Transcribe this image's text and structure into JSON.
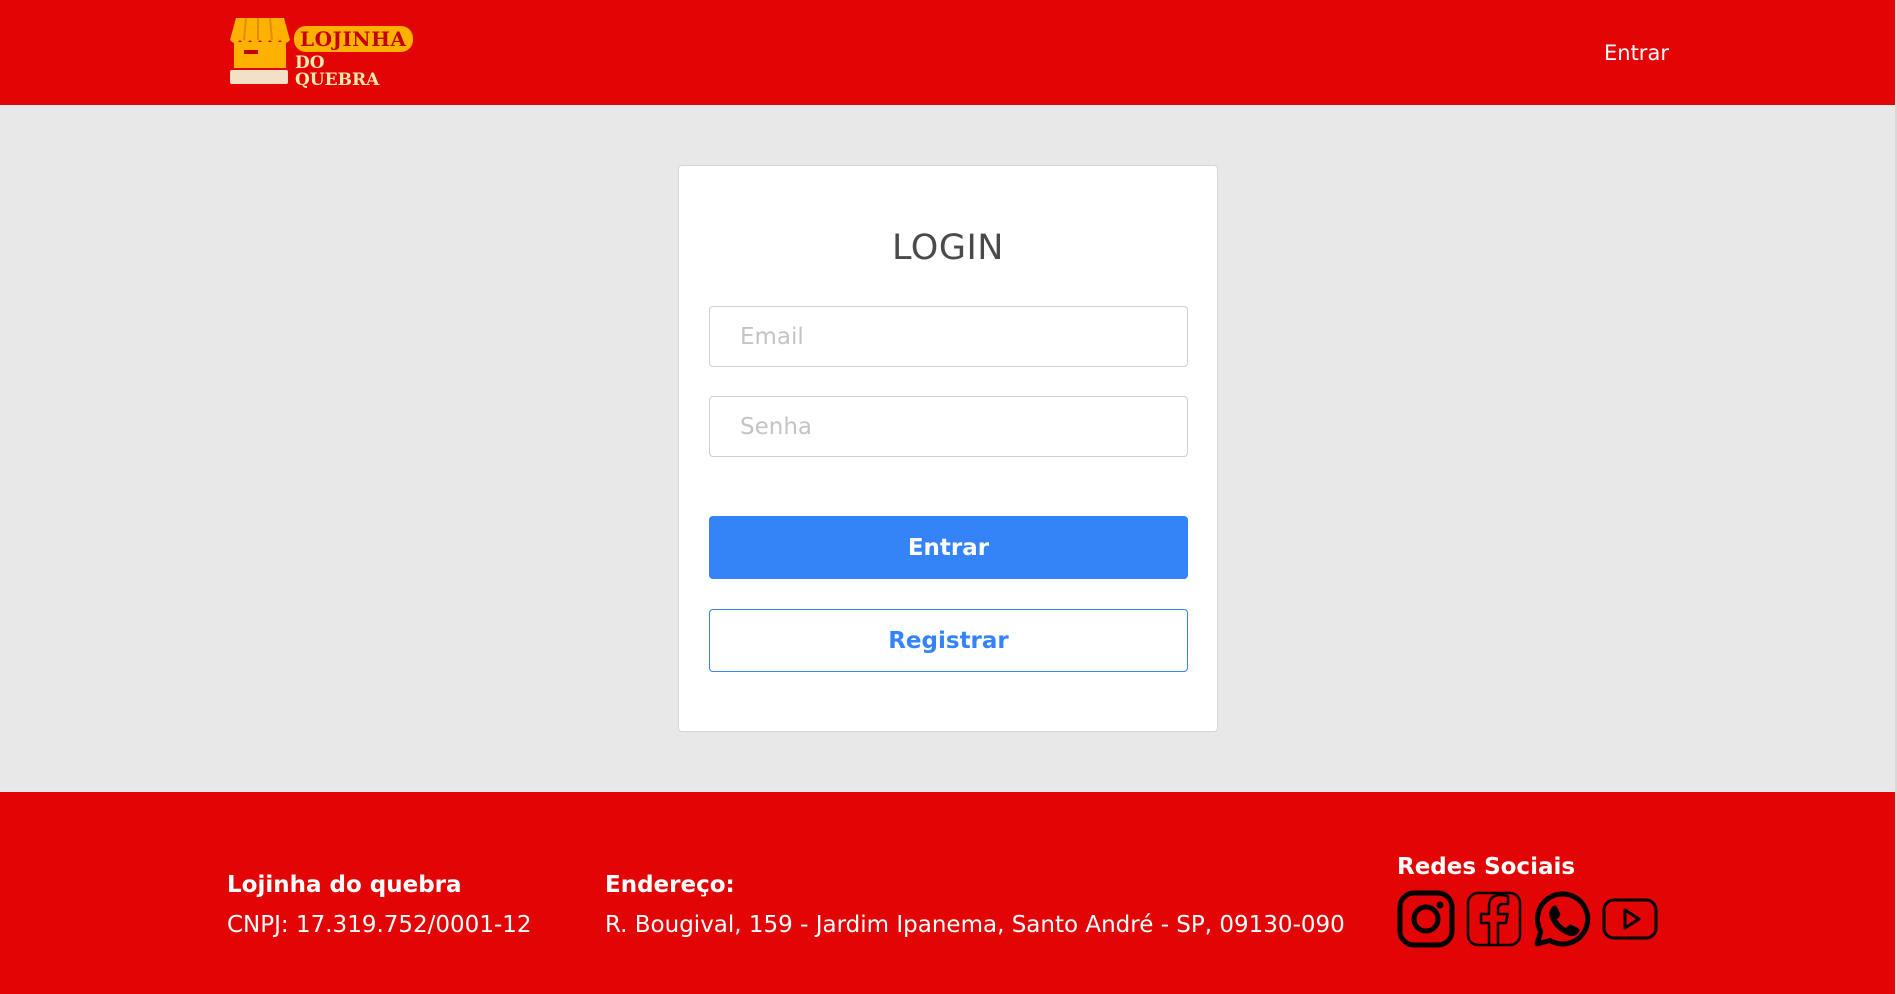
{
  "header": {
    "logo": {
      "line1": "LOJINHA",
      "line2": "DO QUEBRA"
    },
    "nav_login": "Entrar"
  },
  "login": {
    "title": "LOGIN",
    "email_placeholder": "Email",
    "password_placeholder": "Senha",
    "submit_label": "Entrar",
    "register_label": "Registrar"
  },
  "footer": {
    "company_name": "Lojinha do quebra",
    "cnpj": "CNPJ: 17.319.752/0001-12",
    "address_title": "Endereço:",
    "address": "R. Bougival, 159 - Jardim Ipanema, Santo André - SP, 09130-090",
    "social_title": "Redes Sociais",
    "social_icons": [
      "instagram-icon",
      "facebook-icon",
      "whatsapp-icon",
      "youtube-icon"
    ]
  },
  "colors": {
    "brand_red": "#e30505",
    "primary_blue": "#3584f7",
    "background": "#e8e8e8",
    "logo_yellow": "#ffb100"
  }
}
